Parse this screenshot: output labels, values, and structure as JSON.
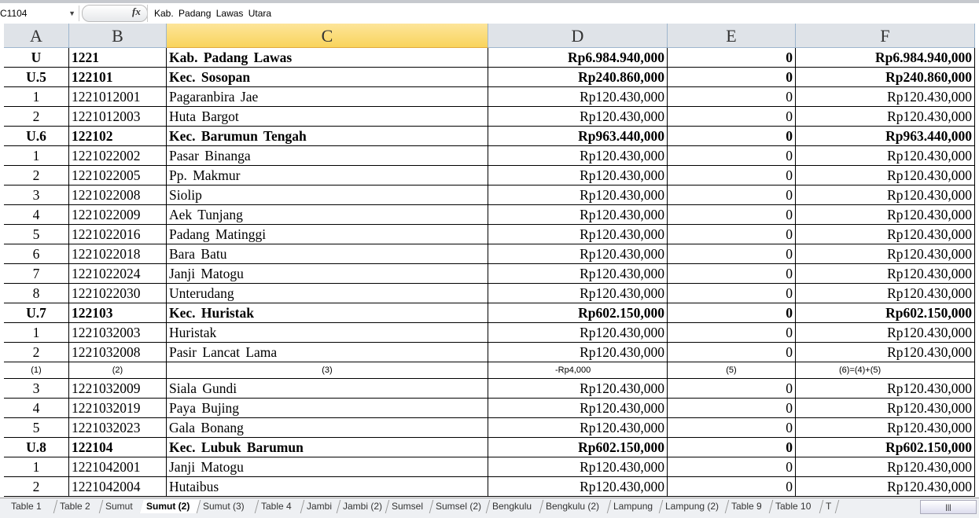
{
  "formula_bar": {
    "name_box": "C1104",
    "formula": "Kab.  Padang  Lawas  Utara",
    "fx_label": "fx"
  },
  "columns": [
    "A",
    "B",
    "C",
    "D",
    "E",
    "F"
  ],
  "selected_column": "C",
  "rows": [
    {
      "bold": true,
      "cells": [
        "U",
        "1221",
        "Kab.  Padang  Lawas",
        "Rp6.984.940,000",
        "0",
        "Rp6.984.940,000"
      ]
    },
    {
      "bold": true,
      "cells": [
        "U.5",
        "122101",
        "Kec.  Sosopan",
        "Rp240.860,000",
        "0",
        "Rp240.860,000"
      ]
    },
    {
      "cells": [
        "1",
        "1221012001",
        "Pagaranbira  Jae",
        "Rp120.430,000",
        "0",
        "Rp120.430,000"
      ]
    },
    {
      "cells": [
        "2",
        "1221012003",
        "Huta  Bargot",
        "Rp120.430,000",
        "0",
        "Rp120.430,000"
      ]
    },
    {
      "bold": true,
      "cells": [
        "U.6",
        "122102",
        "Kec.  Barumun  Tengah",
        "Rp963.440,000",
        "0",
        "Rp963.440,000"
      ]
    },
    {
      "cells": [
        "1",
        "1221022002",
        "Pasar  Binanga",
        "Rp120.430,000",
        "0",
        "Rp120.430,000"
      ]
    },
    {
      "cells": [
        "2",
        "1221022005",
        "Pp.  Makmur",
        "Rp120.430,000",
        "0",
        "Rp120.430,000"
      ]
    },
    {
      "cells": [
        "3",
        "1221022008",
        "Siolip",
        "Rp120.430,000",
        "0",
        "Rp120.430,000"
      ]
    },
    {
      "cells": [
        "4",
        "1221022009",
        "Aek Tunjang",
        "Rp120.430,000",
        "0",
        "Rp120.430,000"
      ]
    },
    {
      "cells": [
        "5",
        "1221022016",
        "Padang  Matinggi",
        "Rp120.430,000",
        "0",
        "Rp120.430,000"
      ]
    },
    {
      "cells": [
        "6",
        "1221022018",
        "Bara  Batu",
        "Rp120.430,000",
        "0",
        "Rp120.430,000"
      ]
    },
    {
      "cells": [
        "7",
        "1221022024",
        "Janji Matogu",
        "Rp120.430,000",
        "0",
        "Rp120.430,000"
      ]
    },
    {
      "cells": [
        "8",
        "1221022030",
        "Unterudang",
        "Rp120.430,000",
        "0",
        "Rp120.430,000"
      ]
    },
    {
      "bold": true,
      "cells": [
        "U.7",
        "122103",
        "Kec.  Huristak",
        "Rp602.150,000",
        "0",
        "Rp602.150,000"
      ]
    },
    {
      "cells": [
        "1",
        "1221032003",
        "Huristak",
        "Rp120.430,000",
        "0",
        "Rp120.430,000"
      ]
    },
    {
      "cells": [
        "2",
        "1221032008",
        "Pasir  Lancat  Lama",
        "Rp120.430,000",
        "0",
        "Rp120.430,000"
      ]
    },
    {
      "small": true,
      "cells": [
        "(1)",
        "(2)",
        "(3)",
        "-Rp4,000",
        "(5)",
        "(6)=(4)+(5)"
      ]
    },
    {
      "cells": [
        "3",
        "1221032009",
        "Siala  Gundi",
        "Rp120.430,000",
        "0",
        "Rp120.430,000"
      ]
    },
    {
      "cells": [
        "4",
        "1221032019",
        "Paya  Bujing",
        "Rp120.430,000",
        "0",
        "Rp120.430,000"
      ]
    },
    {
      "cells": [
        "5",
        "1221032023",
        "Gala  Bonang",
        "Rp120.430,000",
        "0",
        "Rp120.430,000"
      ]
    },
    {
      "bold": true,
      "cells": [
        "U.8",
        "122104",
        "Kec.  Lubuk  Barumun",
        "Rp602.150,000",
        "0",
        "Rp602.150,000"
      ]
    },
    {
      "cells": [
        "1",
        "1221042001",
        "Janji Matogu",
        "Rp120.430,000",
        "0",
        "Rp120.430,000"
      ]
    },
    {
      "cells": [
        "2",
        "1221042004",
        "Hutaibus",
        "Rp120.430,000",
        "0",
        "Rp120.430,000"
      ]
    }
  ],
  "sheet_tabs": [
    "Table 1",
    "Table 2",
    "Sumut",
    "Sumut (2)",
    "Sumut (3)",
    "Table 4",
    "Jambi",
    "Jambi (2)",
    "Sumsel",
    "Sumsel (2)",
    "Bengkulu",
    "Bengkulu (2)",
    "Lampung",
    "Lampung (2)",
    "Table 9",
    "Table 10",
    "T"
  ],
  "active_tab": "Sumut (2)"
}
